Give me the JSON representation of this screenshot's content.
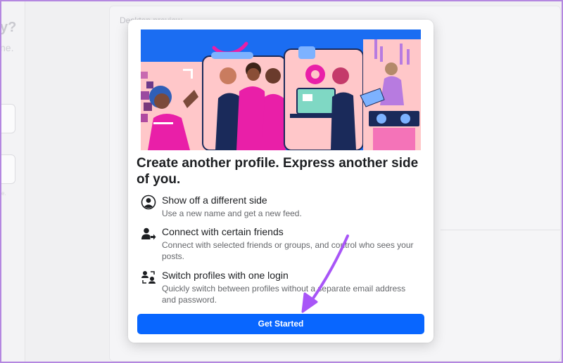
{
  "background": {
    "left_heading_fragment": "y?",
    "left_text_fragment": "ne.",
    "left_tiny_fragment": "e.",
    "preview_label": "Desktop preview"
  },
  "modal": {
    "title": "Create another profile. Express another side of you.",
    "features": [
      {
        "icon": "user-circle-icon",
        "heading": "Show off a different side",
        "description": "Use a new name and get a new feed."
      },
      {
        "icon": "user-share-icon",
        "heading": "Connect with certain friends",
        "description": "Connect with selected friends or groups, and control who sees your posts."
      },
      {
        "icon": "switch-profiles-icon",
        "heading": "Switch profiles with one login",
        "description": "Quickly switch between profiles without a separate email address and password."
      }
    ],
    "button_label": "Get Started"
  },
  "colors": {
    "primary_button": "#0866ff",
    "annotation_arrow": "#a855f7",
    "hero_blue": "#1b6df2",
    "hero_pink": "#ffc7c9",
    "hero_magenta": "#e91fa8"
  }
}
